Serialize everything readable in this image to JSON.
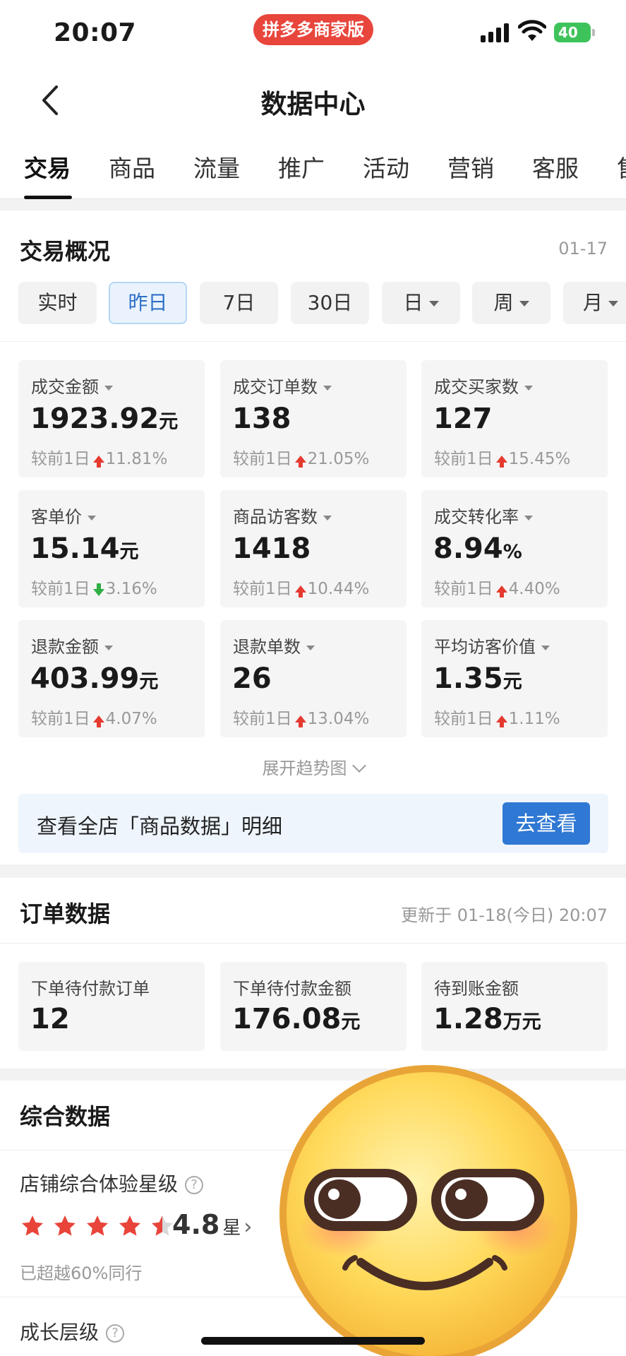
{
  "status_bar": {
    "time": "20:07",
    "badge": "拼多多商家版",
    "battery": "40"
  },
  "header": {
    "title": "数据中心"
  },
  "tabs": [
    {
      "label": "交易",
      "active": true
    },
    {
      "label": "商品"
    },
    {
      "label": "流量"
    },
    {
      "label": "推广"
    },
    {
      "label": "活动"
    },
    {
      "label": "营销"
    },
    {
      "label": "客服"
    },
    {
      "label": "售"
    }
  ],
  "trade_overview": {
    "title": "交易概况",
    "date": "01-17",
    "periods": [
      "实时",
      "昨日",
      "7日",
      "30日",
      "日",
      "周",
      "月"
    ],
    "selected_period": "昨日",
    "metrics": [
      {
        "label": "成交金额",
        "value": "1923.92",
        "unit": "元",
        "compare": "较前1日",
        "change": "11.81%",
        "dir": "up"
      },
      {
        "label": "成交订单数",
        "value": "138",
        "unit": "",
        "compare": "较前1日",
        "change": "21.05%",
        "dir": "up"
      },
      {
        "label": "成交买家数",
        "value": "127",
        "unit": "",
        "compare": "较前1日",
        "change": "15.45%",
        "dir": "up"
      },
      {
        "label": "客单价",
        "value": "15.14",
        "unit": "元",
        "compare": "较前1日",
        "change": "3.16%",
        "dir": "down"
      },
      {
        "label": "商品访客数",
        "value": "1418",
        "unit": "",
        "compare": "较前1日",
        "change": "10.44%",
        "dir": "up"
      },
      {
        "label": "成交转化率",
        "value": "8.94",
        "unit": "%",
        "compare": "较前1日",
        "change": "4.40%",
        "dir": "up"
      },
      {
        "label": "退款金额",
        "value": "403.99",
        "unit": "元",
        "compare": "较前1日",
        "change": "4.07%",
        "dir": "up"
      },
      {
        "label": "退款单数",
        "value": "26",
        "unit": "",
        "compare": "较前1日",
        "change": "13.04%",
        "dir": "up"
      },
      {
        "label": "平均访客价值",
        "value": "1.35",
        "unit": "元",
        "compare": "较前1日",
        "change": "1.11%",
        "dir": "up"
      }
    ],
    "expand_label": "展开趋势图"
  },
  "banner": {
    "text": "查看全店「商品数据」明细",
    "button": "去查看"
  },
  "order_data": {
    "title": "订单数据",
    "updated": "更新于 01-18(今日) 20:07",
    "items": [
      {
        "label": "下单待付款订单",
        "value": "12",
        "unit": ""
      },
      {
        "label": "下单待付款金额",
        "value": "176.08",
        "unit": "元"
      },
      {
        "label": "待到账金额",
        "value": "1.28",
        "unit": "万元"
      }
    ]
  },
  "composite": {
    "title": "综合数据",
    "experience_label": "店铺综合体验星级",
    "rating": "4.8",
    "rating_unit": "星",
    "rating_value": 4.5,
    "surpass_text": "已超越60%同行",
    "growth_label": "成长层级"
  },
  "colors": {
    "accent": "#2f78d3",
    "up": "#e53a2f",
    "down": "#2fae44",
    "badge": "#e8463c"
  }
}
